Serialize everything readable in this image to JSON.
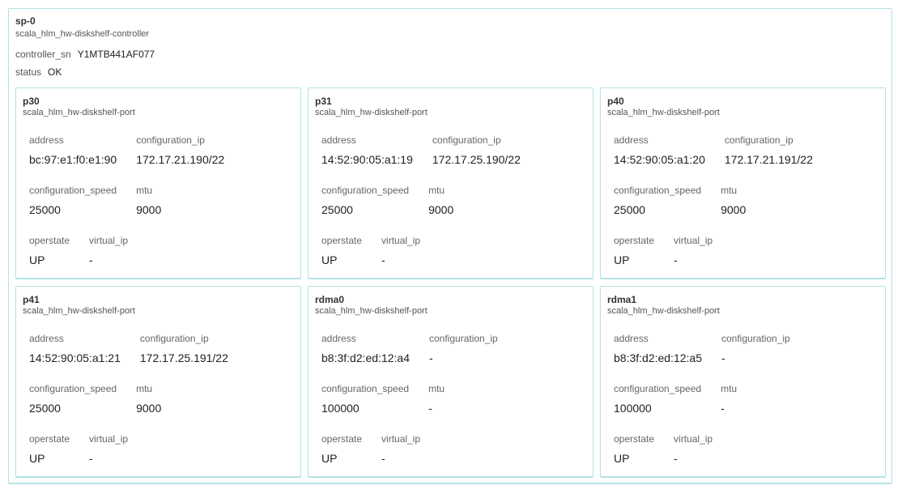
{
  "controller": {
    "name": "sp-0",
    "type": "scala_hlm_hw-diskshelf-controller",
    "sn_label": "controller_sn",
    "sn_value": "Y1MTB441AF077",
    "status_label": "status",
    "status_value": "OK"
  },
  "labels": {
    "address": "address",
    "configuration_ip": "configuration_ip",
    "configuration_speed": "configuration_speed",
    "mtu": "mtu",
    "operstate": "operstate",
    "virtual_ip": "virtual_ip"
  },
  "ports": [
    {
      "name": "p30",
      "type": "scala_hlm_hw-diskshelf-port",
      "address": "bc:97:e1:f0:e1:90",
      "configuration_ip": "172.17.21.190/22",
      "configuration_speed": "25000",
      "mtu": "9000",
      "operstate": "UP",
      "virtual_ip": "-"
    },
    {
      "name": "p31",
      "type": "scala_hlm_hw-diskshelf-port",
      "address": "14:52:90:05:a1:19",
      "configuration_ip": "172.17.25.190/22",
      "configuration_speed": "25000",
      "mtu": "9000",
      "operstate": "UP",
      "virtual_ip": "-"
    },
    {
      "name": "p40",
      "type": "scala_hlm_hw-diskshelf-port",
      "address": "14:52:90:05:a1:20",
      "configuration_ip": "172.17.21.191/22",
      "configuration_speed": "25000",
      "mtu": "9000",
      "operstate": "UP",
      "virtual_ip": "-"
    },
    {
      "name": "p41",
      "type": "scala_hlm_hw-diskshelf-port",
      "address": "14:52:90:05:a1:21",
      "configuration_ip": "172.17.25.191/22",
      "configuration_speed": "25000",
      "mtu": "9000",
      "operstate": "UP",
      "virtual_ip": "-"
    },
    {
      "name": "rdma0",
      "type": "scala_hlm_hw-diskshelf-port",
      "address": "b8:3f:d2:ed:12:a4",
      "configuration_ip": "-",
      "configuration_speed": "100000",
      "mtu": "-",
      "operstate": "UP",
      "virtual_ip": "-"
    },
    {
      "name": "rdma1",
      "type": "scala_hlm_hw-diskshelf-port",
      "address": "b8:3f:d2:ed:12:a5",
      "configuration_ip": "-",
      "configuration_speed": "100000",
      "mtu": "-",
      "operstate": "UP",
      "virtual_ip": "-"
    }
  ]
}
